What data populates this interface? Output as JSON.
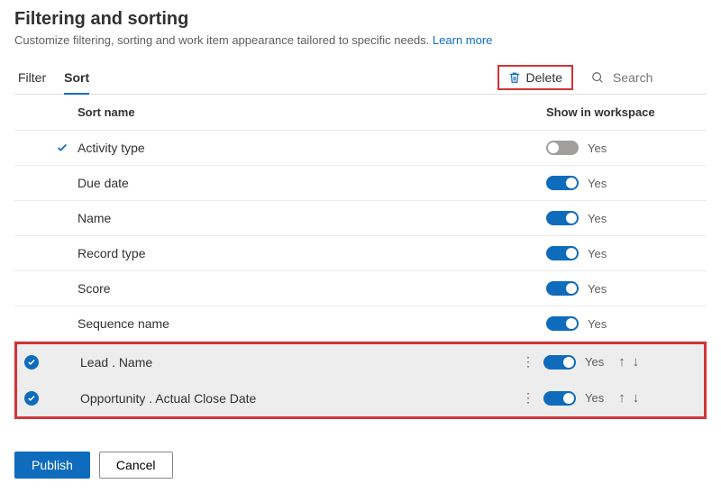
{
  "header": {
    "title": "Filtering and sorting",
    "subtitle": "Customize filtering, sorting and work item appearance tailored to specific needs.",
    "learn_more": "Learn more"
  },
  "tabs": {
    "filter": "Filter",
    "sort": "Sort"
  },
  "toolbar": {
    "delete": "Delete",
    "search_placeholder": "Search"
  },
  "columns": {
    "sort_name": "Sort name",
    "show_in_workspace": "Show in workspace"
  },
  "rows": [
    {
      "name": "Activity type",
      "toggle_label": "Yes"
    },
    {
      "name": "Due date",
      "toggle_label": "Yes"
    },
    {
      "name": "Name",
      "toggle_label": "Yes"
    },
    {
      "name": "Record type",
      "toggle_label": "Yes"
    },
    {
      "name": "Score",
      "toggle_label": "Yes"
    },
    {
      "name": "Sequence name",
      "toggle_label": "Yes"
    },
    {
      "name": "Lead . Name",
      "toggle_label": "Yes"
    },
    {
      "name": "Opportunity . Actual Close Date",
      "toggle_label": "Yes"
    }
  ],
  "footer": {
    "publish": "Publish",
    "cancel": "Cancel"
  }
}
